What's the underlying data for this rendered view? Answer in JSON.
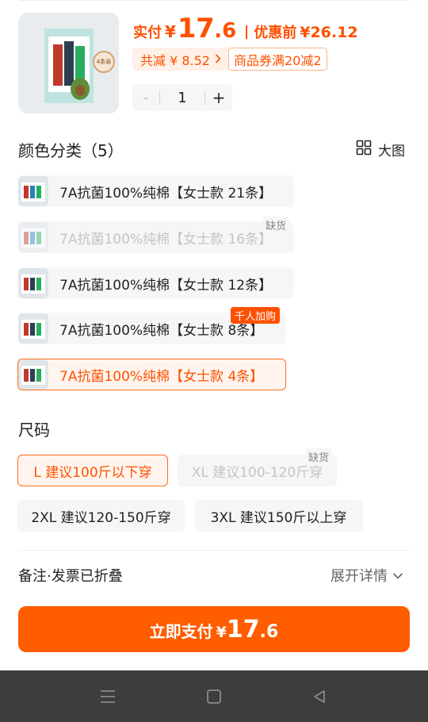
{
  "price": {
    "pay_label": "实付",
    "currency": "¥",
    "pay_int": "17",
    "pay_dec": ".6",
    "pre_label": "优惠前",
    "pre_value": "¥26.12"
  },
  "discount": {
    "label": "共减 ¥ 8.52",
    "chevron": "chevron-right-icon"
  },
  "coupon": {
    "label": "商品券满20减2"
  },
  "quantity": {
    "minus": "-",
    "value": "1",
    "plus": "+"
  },
  "color": {
    "title": "颜色分类（5）",
    "view_label": "大图",
    "options": [
      {
        "label": "7A抗菌100%纯棉【女士款 21条】",
        "state": "normal",
        "tag": ""
      },
      {
        "label": "7A抗菌100%纯棉【女士款 16条】",
        "state": "disabled",
        "tag": "缺货"
      },
      {
        "label": "7A抗菌100%纯棉【女士款 12条】",
        "state": "normal",
        "tag": ""
      },
      {
        "label": "7A抗菌100%纯棉【女士款 8条】",
        "state": "normal",
        "tag": "千人加购"
      },
      {
        "label": "7A抗菌100%纯棉【女士款 4条】",
        "state": "selected",
        "tag": ""
      }
    ]
  },
  "size": {
    "title": "尺码",
    "options": [
      {
        "label": "L 建议100斤以下穿",
        "state": "selected",
        "tag": ""
      },
      {
        "label": "XL 建议100-120斤穿",
        "state": "disabled",
        "tag": "缺货"
      },
      {
        "label": "2XL 建议120-150斤穿",
        "state": "normal",
        "tag": ""
      },
      {
        "label": "3XL 建议150斤以上穿",
        "state": "normal",
        "tag": ""
      }
    ]
  },
  "remark": {
    "label": "备注·发票已折叠",
    "expand_label": "展开详情"
  },
  "pay_button": {
    "label": "立即支付",
    "currency": "¥",
    "int": "17",
    "dec": ".6"
  },
  "nav": {
    "icons": [
      "menu-icon",
      "home-square-icon",
      "back-triangle-icon"
    ]
  },
  "colors": {
    "accent": "#ff5000",
    "button": "#ff5d00",
    "chip_bg": "#f5f6f8",
    "nav_bg": "#3d3d3d"
  }
}
